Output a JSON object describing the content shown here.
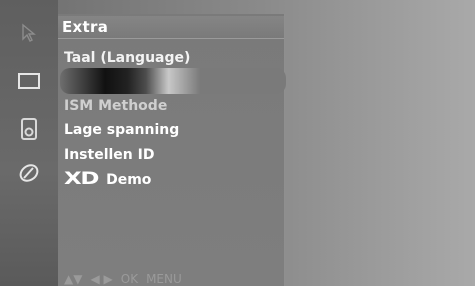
{
  "menu": {
    "title": "Extra",
    "items": [
      {
        "label": "Taal (Language)"
      },
      {
        "label": "ISM Methode"
      },
      {
        "label": "Lage spanning"
      },
      {
        "label": "Instellen ID"
      },
      {
        "label": "Demo",
        "logo_text": "XD"
      }
    ]
  },
  "sidebar": {
    "icons": [
      "cursor-icon",
      "screen-icon",
      "speaker-icon",
      "pencil-icon"
    ]
  },
  "nav_hint": {
    "updown": "▲▼",
    "leftright": "◀ ▶",
    "ok": "OK",
    "menu": "MENU"
  }
}
